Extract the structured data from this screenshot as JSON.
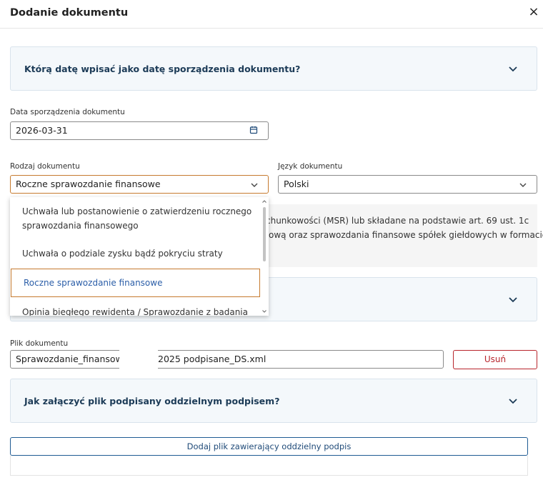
{
  "dialog": {
    "title": "Dodanie dokumentu",
    "close_icon": "×"
  },
  "faq1": {
    "question": "Którą datę wpisać jako datę sporządzenia dokumentu?"
  },
  "date": {
    "label": "Data sporządzenia dokumentu",
    "value": "2026-03-31"
  },
  "doc_type": {
    "label": "Rodzaj dokumentu",
    "value": "Roczne sprawozdanie finansowe"
  },
  "language": {
    "label": "Język dokumentu",
    "value": "Polski"
  },
  "dropdown": {
    "options": [
      "Uchwała lub postanowienie o zatwierdzeniu rocznego",
      "sprawozdania finansowego",
      "Uchwała o podziale zysku bądź pokryciu straty",
      "Roczne sprawozdanie finansowe",
      "Opinia biegłego rewidenta / Sprawozdanie z badania"
    ]
  },
  "info": {
    "line1": "chunkowości (MSR) lub składane na podstawie art. 69 ust. 1c",
    "line2": "ową oraz sprawozdania finansowe spółek giełdowych w formacie",
    "line3": ""
  },
  "file": {
    "label": "Plik dokumentu",
    "name_start": "Sprawozdanie_finansowe_",
    "name_end": "2025 podpisane_DS.xml",
    "remove_label": "Usuń"
  },
  "faq2": {
    "question": "Jak załączyć plik podpisany oddzielnym podpisem?"
  },
  "add_signature_button": "Dodaj plik zawierający oddzielny podpis",
  "colors": {
    "accent_orange": "#c67a2e",
    "navy": "#1c3b57",
    "danger": "#b8252c",
    "link_blue": "#2b5ea8"
  }
}
